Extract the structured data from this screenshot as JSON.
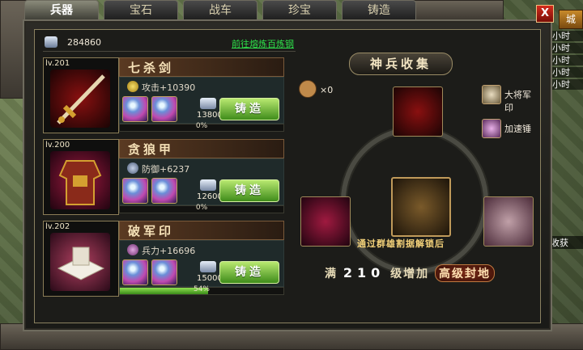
{
  "tabs": [
    "兵器",
    "宝石",
    "战车",
    "珍宝",
    "铸造"
  ],
  "active_tab": 0,
  "close_label": "X",
  "side": {
    "city": "城",
    "items": [
      "小时",
      "小时",
      "小时",
      "小时",
      "小时"
    ],
    "harvest": "收获"
  },
  "resource": {
    "value": "284860",
    "link": "前往熔炼百炼钢"
  },
  "items": [
    {
      "level": "lv.201",
      "name": "七杀剑",
      "stat": "攻击+10390",
      "cost": "13800",
      "forge": "铸造",
      "progress": 0,
      "progress_label": "0%"
    },
    {
      "level": "lv.200",
      "name": "贪狼甲",
      "stat": "防御+6237",
      "cost": "12600",
      "forge": "铸造",
      "progress": 0,
      "progress_label": "0%"
    },
    {
      "level": "lv.202",
      "name": "破军印",
      "stat": "兵力+16696",
      "cost": "15000",
      "forge": "铸造",
      "progress": 0.54,
      "progress_label": "54%"
    }
  ],
  "collection": {
    "title": "神兵收集",
    "hammer_count": "×0",
    "reward1": "大将军印",
    "reward2": "加速锤",
    "unlock_text": "通过群雄割据解锁后",
    "req_prefix": "满",
    "req_level": "210",
    "req_mid": "级增加",
    "req_grant": "高级封地"
  },
  "colors": {
    "forge_green": "#3f8c1a",
    "link_green": "#2ee04a",
    "progress": "#8ee050"
  }
}
